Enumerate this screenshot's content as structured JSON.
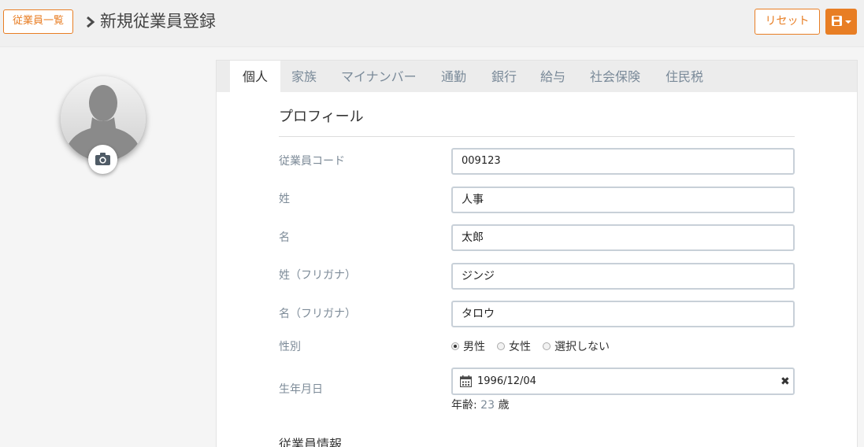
{
  "header": {
    "back_label": "従業員一覧",
    "title": "新規従業員登録",
    "reset_label": "リセット",
    "save_icon": "floppy-disk-icon"
  },
  "avatar": {
    "icon": "person-silhouette-icon",
    "camera_icon": "camera-icon"
  },
  "tabs": [
    {
      "label": "個人"
    },
    {
      "label": "家族"
    },
    {
      "label": "マイナンバー"
    },
    {
      "label": "通勤"
    },
    {
      "label": "銀行"
    },
    {
      "label": "給与"
    },
    {
      "label": "社会保険"
    },
    {
      "label": "住民税"
    }
  ],
  "profile": {
    "section_title": "プロフィール",
    "fields": [
      {
        "label": "従業員コード",
        "value": "009123"
      },
      {
        "label": "姓",
        "value": "人事"
      },
      {
        "label": "名",
        "value": "太郎"
      },
      {
        "label": "姓（フリガナ）",
        "value": "ジンジ"
      },
      {
        "label": "名（フリガナ）",
        "value": "タロウ"
      }
    ],
    "gender": {
      "label": "性別",
      "options": [
        "男性",
        "女性",
        "選択しない"
      ],
      "selected": "男性"
    },
    "birthday": {
      "label": "生年月日",
      "value": "1996/12/04",
      "age_prefix": "年齢:",
      "age_value": "23",
      "age_unit": "歳"
    }
  },
  "employee_info": {
    "section_title": "従業員情報"
  },
  "colors": {
    "accent": "#e87e24",
    "label": "#7d8b98"
  }
}
